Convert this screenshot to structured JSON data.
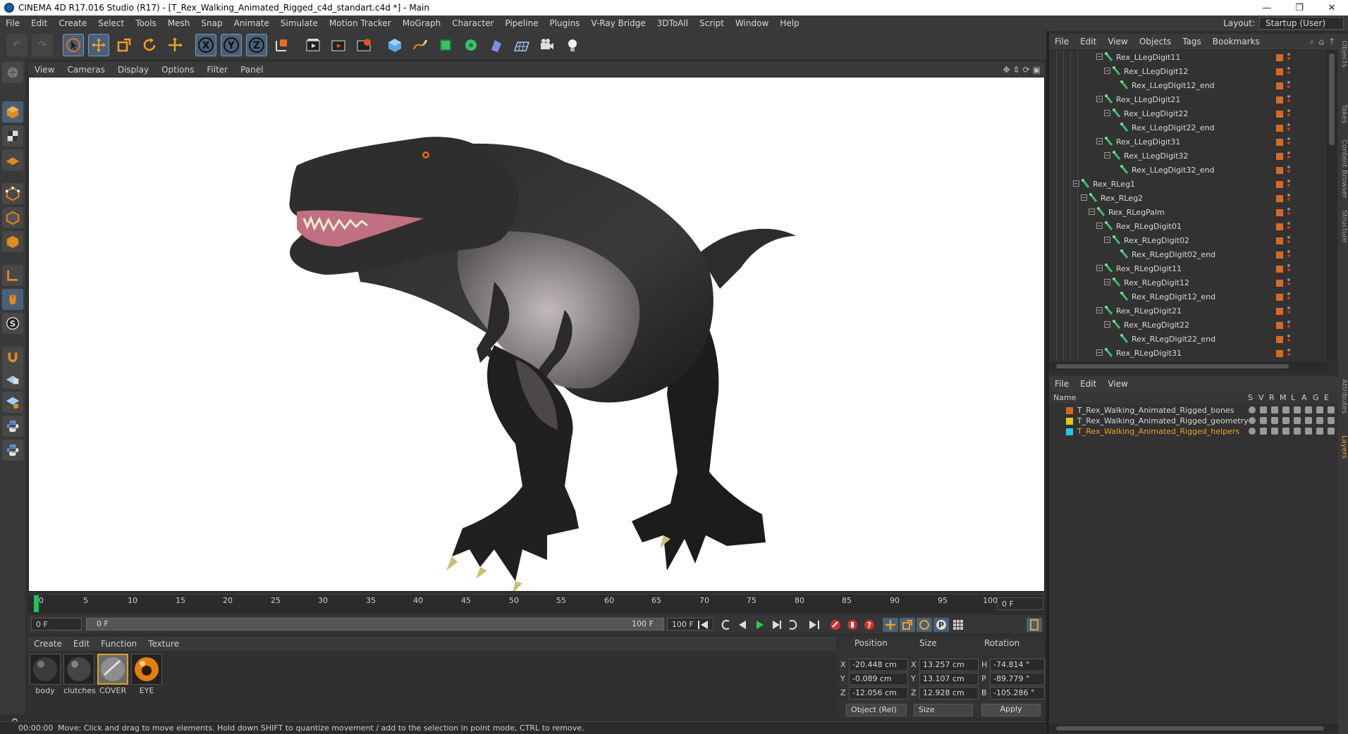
{
  "window": {
    "title": "CINEMA 4D R17.016 Studio (R17) - [T_Rex_Walking_Animated_Rigged_c4d_standart.c4d *] - Main"
  },
  "menubar": {
    "items": [
      "File",
      "Edit",
      "Create",
      "Select",
      "Tools",
      "Mesh",
      "Snap",
      "Animate",
      "Simulate",
      "Motion Tracker",
      "MoGraph",
      "Character",
      "Pipeline",
      "Plugins",
      "V-Ray Bridge",
      "3DToAll",
      "Script",
      "Window",
      "Help"
    ],
    "layout_label": "Layout:",
    "layout_value": "Startup (User)"
  },
  "toolbar": {
    "axis_labels": [
      "X",
      "Y",
      "Z"
    ]
  },
  "viewport": {
    "menu": [
      "View",
      "Cameras",
      "Display",
      "Options",
      "Filter",
      "Panel"
    ]
  },
  "timeline": {
    "ticks": [
      "0",
      "5",
      "10",
      "15",
      "20",
      "25",
      "30",
      "35",
      "40",
      "45",
      "50",
      "55",
      "60",
      "65",
      "70",
      "75",
      "80",
      "85",
      "90",
      "95",
      "100"
    ],
    "current_frame_right": "0 F",
    "start_field": "0 F",
    "range_start": "0 F",
    "range_end": "100 F",
    "end_field": "100 F"
  },
  "materials": {
    "menu": [
      "Create",
      "Edit",
      "Function",
      "Texture"
    ],
    "items": [
      {
        "name": "body"
      },
      {
        "name": "clutches"
      },
      {
        "name": "COVER"
      },
      {
        "name": "EYE"
      }
    ]
  },
  "coordinates": {
    "headers": {
      "position": "Position",
      "size": "Size",
      "rotation": "Rotation"
    },
    "rows": [
      {
        "axis": "X",
        "pos": "-20.448 cm",
        "size_axis": "X",
        "size": "13.257 cm",
        "rot_axis": "H",
        "rot": "-74.814 °"
      },
      {
        "axis": "Y",
        "pos": "-0.089 cm",
        "size_axis": "Y",
        "size": "13.107 cm",
        "rot_axis": "P",
        "rot": "-89.779 °"
      },
      {
        "axis": "Z",
        "pos": "-12.056 cm",
        "size_axis": "Z",
        "size": "12.928 cm",
        "rot_axis": "B",
        "rot": "-105.286 °"
      }
    ],
    "mode": "Object (Rel)",
    "size_mode": "Size",
    "apply": "Apply"
  },
  "status": {
    "time": "00:00:00",
    "message": "Move: Click and drag to move elements. Hold down SHIFT to quantize movement / add to the selection in point mode, CTRL to remove."
  },
  "object_manager": {
    "menu": [
      "File",
      "Edit",
      "View",
      "Objects",
      "Tags",
      "Bookmarks"
    ],
    "rows": [
      {
        "name": "Rex_LLegDigit11",
        "depth": 3,
        "expand": true
      },
      {
        "name": "Rex_LLegDigit12",
        "depth": 4,
        "expand": true
      },
      {
        "name": "Rex_LLegDigit12_end",
        "depth": 5,
        "expand": false
      },
      {
        "name": "Rex_LLegDigit21",
        "depth": 3,
        "expand": true
      },
      {
        "name": "Rex_LLegDigit22",
        "depth": 4,
        "expand": true
      },
      {
        "name": "Rex_LLegDigit22_end",
        "depth": 5,
        "expand": false
      },
      {
        "name": "Rex_LLegDigit31",
        "depth": 3,
        "expand": true
      },
      {
        "name": "Rex_LLegDigit32",
        "depth": 4,
        "expand": true
      },
      {
        "name": "Rex_LLegDigit32_end",
        "depth": 5,
        "expand": false
      },
      {
        "name": "Rex_RLeg1",
        "depth": 0,
        "expand": true
      },
      {
        "name": "Rex_RLeg2",
        "depth": 1,
        "expand": true
      },
      {
        "name": "Rex_RLegPalm",
        "depth": 2,
        "expand": true
      },
      {
        "name": "Rex_RLegDigit01",
        "depth": 3,
        "expand": true
      },
      {
        "name": "Rex_RLegDigit02",
        "depth": 4,
        "expand": true
      },
      {
        "name": "Rex_RLegDigit02_end",
        "depth": 5,
        "expand": false
      },
      {
        "name": "Rex_RLegDigit11",
        "depth": 3,
        "expand": true
      },
      {
        "name": "Rex_RLegDigit12",
        "depth": 4,
        "expand": true
      },
      {
        "name": "Rex_RLegDigit12_end",
        "depth": 5,
        "expand": false
      },
      {
        "name": "Rex_RLegDigit21",
        "depth": 3,
        "expand": true
      },
      {
        "name": "Rex_RLegDigit22",
        "depth": 4,
        "expand": true
      },
      {
        "name": "Rex_RLegDigit22_end",
        "depth": 5,
        "expand": false
      },
      {
        "name": "Rex_RLegDigit31",
        "depth": 3,
        "expand": true
      }
    ]
  },
  "layer_manager": {
    "menu": [
      "File",
      "Edit",
      "View"
    ],
    "columns": {
      "name": "Name",
      "flags": [
        "S",
        "V",
        "R",
        "M",
        "L",
        "A",
        "G",
        "E"
      ]
    },
    "layers": [
      {
        "name": "T_Rex_Walking_Animated_Rigged_bones",
        "color": "#d2691e",
        "text_color": "#d8d8d8"
      },
      {
        "name": "T_Rex_Walking_Animated_Rigged_geometry",
        "color": "#e6c619",
        "text_color": "#d8d8d8"
      },
      {
        "name": "T_Rex_Walking_Animated_Rigged_helpers",
        "color": "#22c6e8",
        "text_color": "#f0a020"
      }
    ]
  },
  "side_tabs": [
    "Objects",
    "Takes",
    "Content Browser",
    "Structure",
    "Attributes",
    "Layers"
  ],
  "colors": {
    "accent": "#4a6078",
    "tag_orange": "#d66a24",
    "playhead": "#19c45a"
  }
}
